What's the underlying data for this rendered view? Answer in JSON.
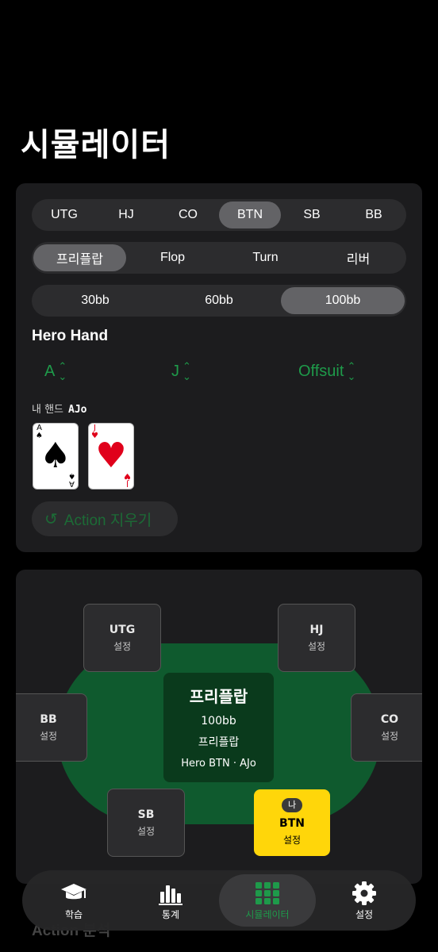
{
  "page": {
    "title": "시뮬레이터"
  },
  "positions": {
    "options": [
      "UTG",
      "HJ",
      "CO",
      "BTN",
      "SB",
      "BB"
    ],
    "selected": "BTN"
  },
  "streets": {
    "options": [
      "프리플랍",
      "Flop",
      "Turn",
      "리버"
    ],
    "selected": "프리플랍"
  },
  "stacks": {
    "options": [
      "30bb",
      "60bb",
      "100bb"
    ],
    "selected": "100bb"
  },
  "hero": {
    "title": "Hero Hand",
    "rank1": "A",
    "rank2": "J",
    "suitedness": "Offsuit",
    "my_hand_label": "내 핸드",
    "my_hand_value": "AJo",
    "cards": [
      {
        "rank": "A",
        "suit": "spade",
        "color": "#000000"
      },
      {
        "rank": "J",
        "suit": "heart",
        "color": "#e0001b"
      }
    ]
  },
  "clear_button": {
    "label": "Action 지우기"
  },
  "table": {
    "center": {
      "title": "프리플랍",
      "stack": "100bb",
      "street": "프리플랍",
      "hero_line": "Hero BTN · AJo"
    },
    "seats": {
      "utg": {
        "name": "UTG",
        "sub": "설정"
      },
      "hj": {
        "name": "HJ",
        "sub": "설정"
      },
      "bb": {
        "name": "BB",
        "sub": "설정"
      },
      "co": {
        "name": "CO",
        "sub": "설정"
      },
      "sb": {
        "name": "SB",
        "sub": "설정"
      },
      "btn": {
        "name": "BTN",
        "sub": "설정",
        "badge": "나"
      }
    }
  },
  "under_text": "Action 분석",
  "tabbar": {
    "items": [
      {
        "label": "학습",
        "icon": "graduation-cap-icon"
      },
      {
        "label": "통계",
        "icon": "bar-chart-icon"
      },
      {
        "label": "시뮬레이터",
        "icon": "grid-icon",
        "active": true
      },
      {
        "label": "설정",
        "icon": "gear-icon"
      }
    ]
  },
  "colors": {
    "accent": "#1e9a4a",
    "hero_seat": "#ffd60a",
    "felt": "#0f5a2e"
  }
}
